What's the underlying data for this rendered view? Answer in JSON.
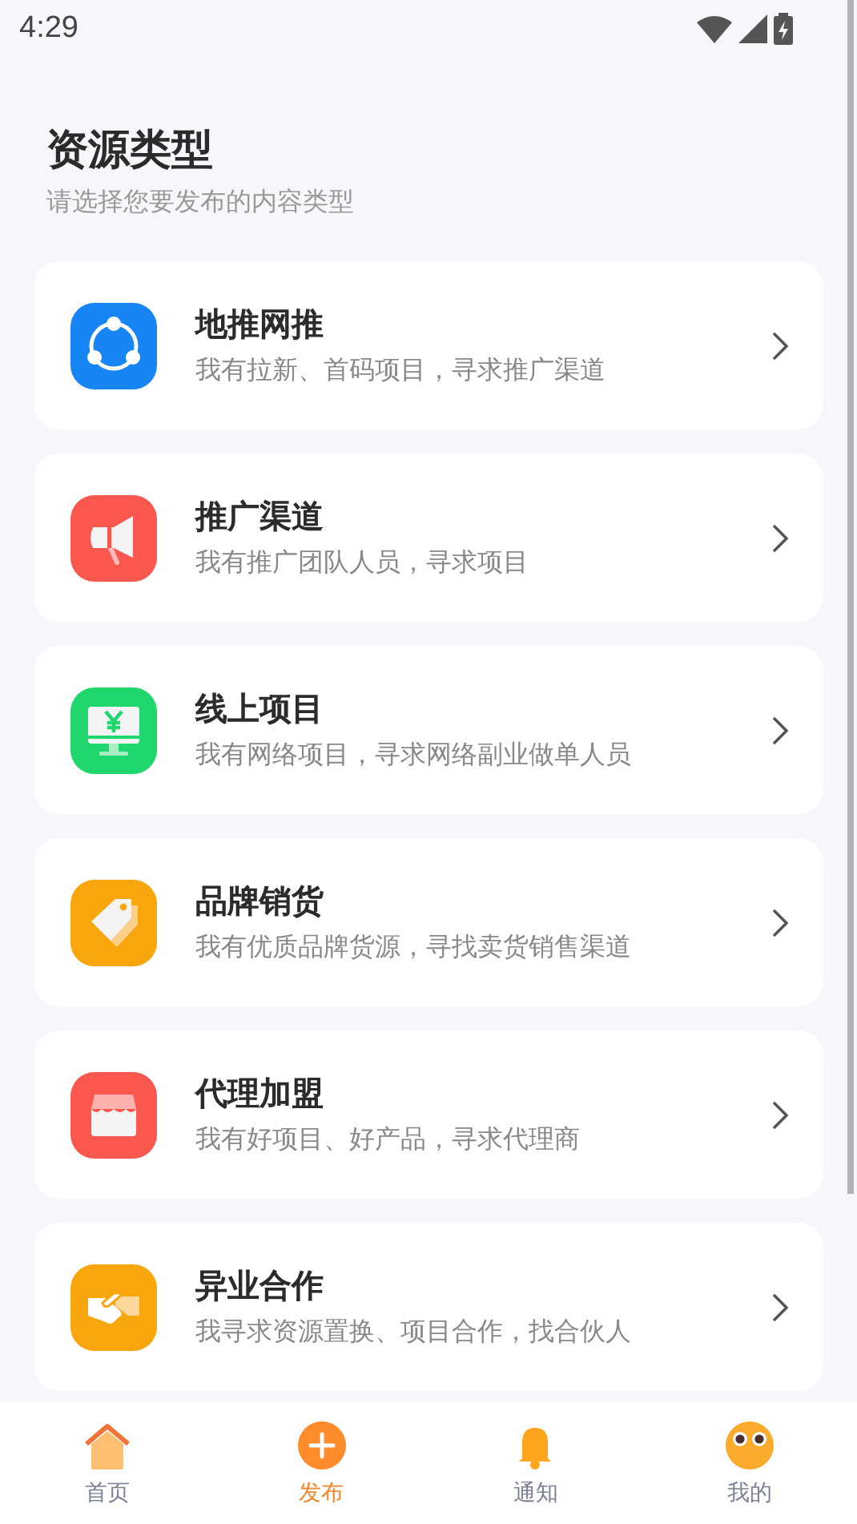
{
  "status_bar": {
    "time": "4:29"
  },
  "header": {
    "title": "资源类型",
    "subtitle": "请选择您要发布的内容类型"
  },
  "options": [
    {
      "title": "地推网推",
      "description": "我有拉新、首码项目，寻求推广渠道",
      "color": "#1785f5"
    },
    {
      "title": "推广渠道",
      "description": "我有推广团队人员，寻求项目",
      "color": "#fa574f"
    },
    {
      "title": "线上项目",
      "description": "我有网络项目，寻求网络副业做单人员",
      "color": "#20d76d"
    },
    {
      "title": "品牌销货",
      "description": "我有优质品牌货源，寻找卖货销售渠道",
      "color": "#f9a50c"
    },
    {
      "title": "代理加盟",
      "description": "我有好项目、好产品，寻求代理商",
      "color": "#fa574f"
    },
    {
      "title": "异业合作",
      "description": "我寻求资源置换、项目合作，找合伙人",
      "color": "#f9a50c"
    }
  ],
  "tab_bar": [
    {
      "label": "首页",
      "selected": false
    },
    {
      "label": "发布",
      "selected": true
    },
    {
      "label": "通知",
      "selected": false
    },
    {
      "label": "我的",
      "selected": false
    }
  ]
}
